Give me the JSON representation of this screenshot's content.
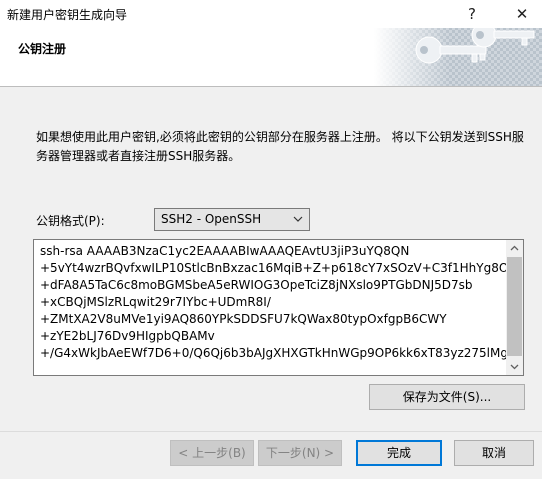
{
  "window": {
    "title": "新建用户密钥生成向导",
    "help_label": "?",
    "close_label": "✕"
  },
  "header": {
    "title": "公钥注册",
    "banner_icon": "key-icon"
  },
  "main": {
    "description": "如果想使用此用户密钥,必须将此密钥的公钥部分在服务器上注册。 将以下公钥发送到SSH服务器管理器或者直接注册SSH服务器。",
    "format_label": "公钥格式(P):",
    "format_value": "SSH2 - OpenSSH",
    "public_key": "ssh-rsa AAAAB3NzaC1yc2EAAAABIwAAAQEAvtU3jiP3uYQ8QN\n+5vYt4wzrBQvfxwILP10StlcBnBxzac16MqiB+Z+p618cY7xSOzV+C3f1HhYg8O\n+dFA8A5TaC6c8moBGMSbeA5eRWIOG3OpeTciZ8jNXslo9PTGbDNJ5D7sb\n+xCBQjMSlzRLqwit29r7IYbc+UDmR8I/\n+ZMtXA2V8uMVe1yi9AQ860YPkSDDSFU7kQWax80typOxfgpB6CWY\n+zYE2bLJ76Dv9HIgpbQBAMv\n+/G4xWkJbAeEWf7D6+0/Q6Qj6b3bAJgXHXGTkHnWGp9OP6kk6xT83yz275lMg",
    "save_button": "保存为文件(S)..."
  },
  "footer": {
    "back_button": "< 上一步(B)",
    "next_button": "下一步(N) >",
    "finish_button": "完成",
    "cancel_button": "取消"
  },
  "colors": {
    "accent": "#0078d7",
    "banner_dark": "#8a9bab",
    "banner_light": "#d7dde3"
  }
}
